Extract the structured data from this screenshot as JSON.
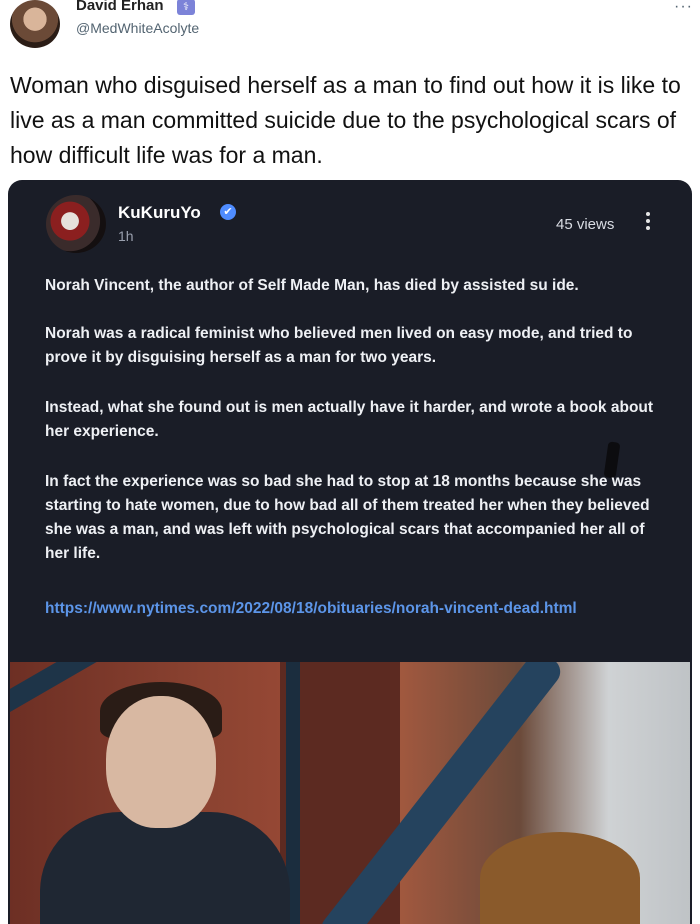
{
  "outer": {
    "author_name": "David Erhan",
    "badge_glyph": "⚕",
    "handle": "@MedWhiteAcolyte",
    "more_icon": "···",
    "text": "Woman who disguised herself as a man to find out how it is like to live as a man committed suicide due to the psychological scars of how difficult life was for a man."
  },
  "embedded": {
    "author_name": "KuKuruYo",
    "verified_glyph": "✔",
    "time": "1h",
    "views": "45 views",
    "paragraphs": [
      "Norah Vincent, the author of Self Made Man, has died by assisted su  ide.",
      "Norah was a radical feminist who believed men lived on easy mode, and tried to prove it by disguising herself as a man for two years.",
      "Instead, what she found out is men actually have it harder, and wrote a book about her experience.",
      "In fact the experience was so bad she had to stop at 18 months because she was starting to hate women, due to how bad all of them treated her when they believed she was a man, and was left with psychological scars that accompanied her all of her life."
    ],
    "link": "https://www.nytimes.com/2022/08/18/obituaries/norah-vincent-dead.html"
  },
  "colors": {
    "card_bg": "#1a1d27",
    "link": "#5c95e8",
    "verified": "#4f8cff"
  }
}
